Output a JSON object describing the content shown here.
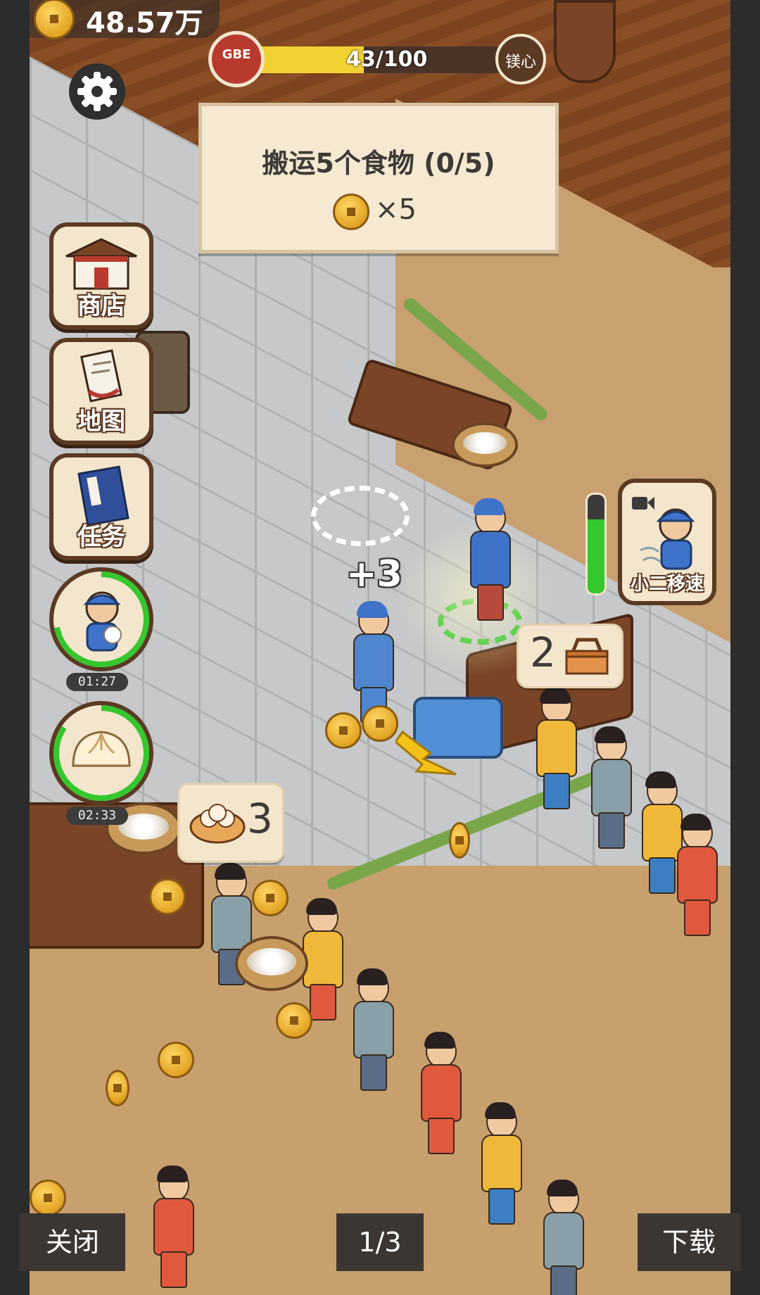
{
  "hud": {
    "currency_amount": "48.57万",
    "level_emblem_text": "GBE",
    "progress_text": "43/100",
    "progress_fraction": 0.43,
    "heart_button_label": "镁心"
  },
  "task_banner": {
    "title": "搬运5个食物 (0/5)",
    "reward_text": "×5"
  },
  "side_menu": {
    "shop_label": "商店",
    "map_label": "地图",
    "tasks_label": "任务",
    "waiter_timer": "01:27",
    "bun_timer": "02:33"
  },
  "right_panel": {
    "speed_label": "小二移速",
    "speed_level": 0.75
  },
  "scene": {
    "floating_gain": "+3",
    "table_food_count": "2",
    "counter_bun_count": "3"
  },
  "bottom_bar": {
    "close_label": "关闭",
    "page_indicator": "1/3",
    "download_label": "下载"
  },
  "colors": {
    "accent_gold": "#e2a322",
    "panel_cream": "#f3e6cd",
    "frame_brown": "#5b3a24",
    "progress_yellow": "#f2d233",
    "ring_green": "#34c72e"
  }
}
